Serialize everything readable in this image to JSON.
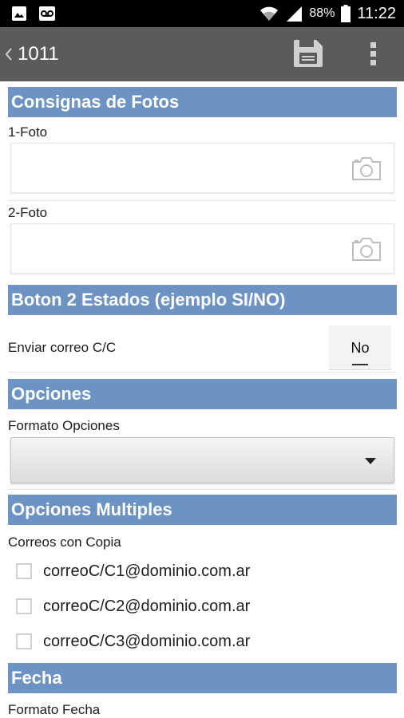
{
  "status_bar": {
    "battery": "88%",
    "time": "11:22",
    "icons": [
      "image-notification-icon",
      "voicemail-icon",
      "wifi-icon",
      "cell-signal-icon",
      "battery-icon"
    ]
  },
  "action_bar": {
    "back_icon": "chevron-left-icon",
    "title": "1011",
    "save_icon": "save-icon",
    "menu_icon": "overflow-menu-icon"
  },
  "sections": {
    "photos": {
      "header": "Consignas de Fotos",
      "fields": [
        {
          "label": "1-Foto",
          "icon": "camera-icon"
        },
        {
          "label": "2-Foto",
          "icon": "camera-icon"
        }
      ]
    },
    "toggle": {
      "header": "Boton 2 Estados (ejemplo SI/NO)",
      "label": "Enviar correo C/C",
      "value": "No"
    },
    "options": {
      "header": "Opciones",
      "label": "Formato Opciones",
      "selected": ""
    },
    "multiple": {
      "header": "Opciones Multiples",
      "label": "Correos con Copia",
      "items": [
        {
          "label": "correoC/C1@dominio.com.ar",
          "checked": false
        },
        {
          "label": "correoC/C2@dominio.com.ar",
          "checked": false
        },
        {
          "label": "correoC/C3@dominio.com.ar",
          "checked": false
        }
      ]
    },
    "date": {
      "header": "Fecha",
      "label": "Formato Fecha"
    }
  },
  "colors": {
    "section_header": "#6c93c4",
    "action_bar": "#5b5b5b",
    "status_bar": "#000000"
  }
}
